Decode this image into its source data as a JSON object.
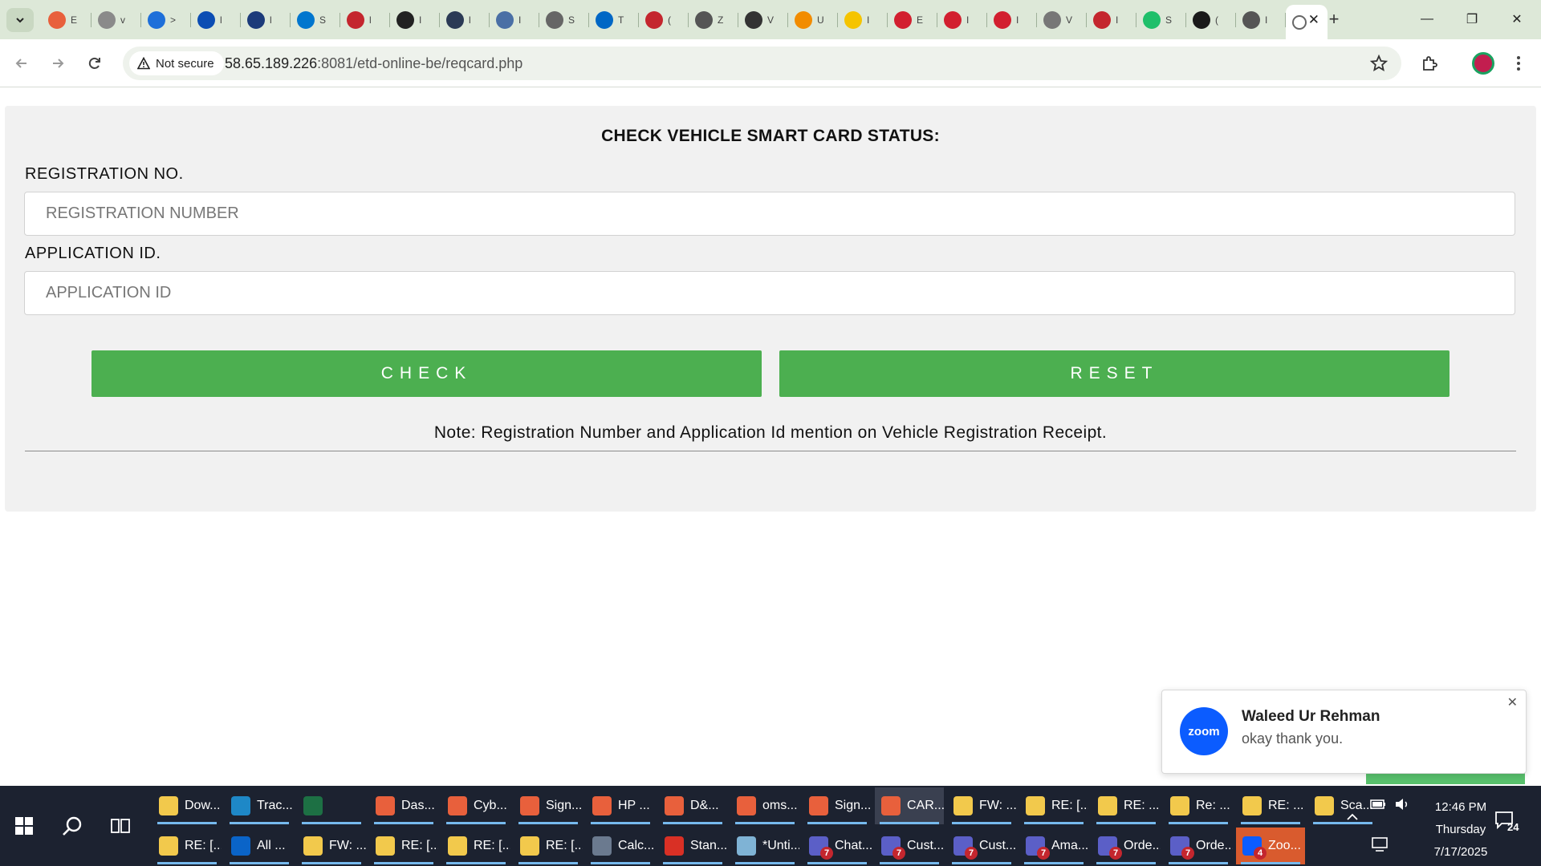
{
  "browser": {
    "tabs": [
      {
        "favicon": "chrome-icon",
        "color": "#e8603c",
        "title": "E"
      },
      {
        "favicon": "globe-icon",
        "color": "#8a8a8a",
        "title": "v"
      },
      {
        "favicon": "hand-icon",
        "color": "#1e6fd9",
        "title": ">"
      },
      {
        "favicon": "u-icon",
        "color": "#0b4db3",
        "title": "l"
      },
      {
        "favicon": "mail-icon",
        "color": "#1c3b7a",
        "title": "l"
      },
      {
        "favicon": "dell-icon",
        "color": "#0076ce",
        "title": "S"
      },
      {
        "favicon": "target-icon",
        "color": "#c4262e",
        "title": "l"
      },
      {
        "favicon": "m-icon",
        "color": "#222222",
        "title": "I"
      },
      {
        "favicon": "ring-icon",
        "color": "#2b3a55",
        "title": "l"
      },
      {
        "favicon": "compass-icon",
        "color": "#4a6fa5",
        "title": "I"
      },
      {
        "favicon": "globe-icon",
        "color": "#666666",
        "title": "S"
      },
      {
        "favicon": "etn-icon",
        "color": "#0067c5",
        "title": "T"
      },
      {
        "favicon": "plane-icon",
        "color": "#c4262e",
        "title": "("
      },
      {
        "favicon": "headset-icon",
        "color": "#555555",
        "title": "Z"
      },
      {
        "favicon": "horse-icon",
        "color": "#333333",
        "title": "V"
      },
      {
        "favicon": "u-orange-icon",
        "color": "#f28c00",
        "title": "U"
      },
      {
        "favicon": "fluke-icon",
        "color": "#f5c400",
        "title": "I"
      },
      {
        "favicon": "cube-icon",
        "color": "#d21f2f",
        "title": "E"
      },
      {
        "favicon": "shield-icon",
        "color": "#d21f2f",
        "title": "I"
      },
      {
        "favicon": "shield-icon",
        "color": "#d21f2f",
        "title": "I"
      },
      {
        "favicon": "linkedin-icon",
        "color": "#777777",
        "title": "V"
      },
      {
        "favicon": "target-icon",
        "color": "#c4262e",
        "title": "I"
      },
      {
        "favicon": "iq-icon",
        "color": "#1fbf6a",
        "title": "S"
      },
      {
        "favicon": "m-icon",
        "color": "#1a1a1a",
        "title": "("
      },
      {
        "favicon": "globe-icon",
        "color": "#555555",
        "title": "I"
      }
    ],
    "active_tab": {
      "title": "(",
      "close": "✕"
    },
    "new_tab": "+",
    "window": {
      "minimize": "—",
      "maximize": "❐",
      "close": "✕"
    },
    "address": {
      "security_label": "Not secure",
      "host": "58.65.189.226",
      "path": ":8081/etd-online-be/reqcard.php"
    }
  },
  "page": {
    "title": "CHECK VEHICLE SMART CARD STATUS:",
    "registration": {
      "label": "REGISTRATION NO.",
      "placeholder": "REGISTRATION NUMBER",
      "value": ""
    },
    "application": {
      "label": "APPLICATION ID.",
      "placeholder": "APPLICATION ID",
      "value": ""
    },
    "check_button": "CHECK",
    "reset_button": "RESET",
    "note": "Note: Registration Number and Application Id mention on Vehicle Registration Receipt.",
    "button_color": "#4caf50"
  },
  "zoom_toast": {
    "logo": "zoom",
    "sender": "Waleed Ur Rehman",
    "message": "okay thank you.",
    "close": "✕"
  },
  "taskbar": {
    "row1": [
      {
        "icon": "explorer-icon",
        "color": "#f2c94c",
        "label": "Dow..."
      },
      {
        "icon": "edge-icon",
        "color": "#1e88c7",
        "label": "Trac..."
      },
      {
        "icon": "excel-icon",
        "color": "#1d7044",
        "label": ""
      },
      {
        "icon": "chrome-icon",
        "color": "#e8603c",
        "label": "Das..."
      },
      {
        "icon": "chrome-icon",
        "color": "#e8603c",
        "label": "Cyb..."
      },
      {
        "icon": "chrome-icon",
        "color": "#e8603c",
        "label": "Sign..."
      },
      {
        "icon": "chrome-icon",
        "color": "#e8603c",
        "label": "HP ..."
      },
      {
        "icon": "chrome-icon",
        "color": "#e8603c",
        "label": "D&..."
      },
      {
        "icon": "chrome-icon",
        "color": "#e8603c",
        "label": "oms..."
      },
      {
        "icon": "chrome-icon",
        "color": "#e8603c",
        "label": "Sign..."
      },
      {
        "icon": "chrome-icon",
        "color": "#e8603c",
        "label": "CAR..."
      },
      {
        "icon": "mail-icon",
        "color": "#f2c94c",
        "label": "FW: ..."
      },
      {
        "icon": "mail-icon",
        "color": "#f2c94c",
        "label": "RE: [..."
      },
      {
        "icon": "mail-icon",
        "color": "#f2c94c",
        "label": "RE: ..."
      },
      {
        "icon": "mail-icon",
        "color": "#f2c94c",
        "label": "Re: ..."
      },
      {
        "icon": "mail-icon",
        "color": "#f2c94c",
        "label": "RE: ..."
      },
      {
        "icon": "mail-icon",
        "color": "#f2c94c",
        "label": "Sca..."
      }
    ],
    "row2": [
      {
        "icon": "mail-icon",
        "color": "#f2c94c",
        "label": "RE: [..."
      },
      {
        "icon": "outlook-icon",
        "color": "#0a64c8",
        "label": "All ..."
      },
      {
        "icon": "mail-icon",
        "color": "#f2c94c",
        "label": "FW: ..."
      },
      {
        "icon": "mail-icon",
        "color": "#f2c94c",
        "label": "RE: [..."
      },
      {
        "icon": "mail-icon",
        "color": "#f2c94c",
        "label": "RE: [..."
      },
      {
        "icon": "mail-icon",
        "color": "#f2c94c",
        "label": "RE: [..."
      },
      {
        "icon": "calculator-icon",
        "color": "#6b7a8f",
        "label": "Calc..."
      },
      {
        "icon": "pdf-icon",
        "color": "#d93025",
        "label": "Stan..."
      },
      {
        "icon": "notepad-icon",
        "color": "#7fb3d5",
        "label": "*Unti..."
      },
      {
        "icon": "teams-icon",
        "color": "#5b5fc7",
        "label": "Chat...",
        "badge": "7"
      },
      {
        "icon": "teams-icon",
        "color": "#5b5fc7",
        "label": "Cust...",
        "badge": "7"
      },
      {
        "icon": "teams-icon",
        "color": "#5b5fc7",
        "label": "Cust...",
        "badge": "7"
      },
      {
        "icon": "teams-icon",
        "color": "#5b5fc7",
        "label": "Ama...",
        "badge": "7"
      },
      {
        "icon": "teams-icon",
        "color": "#5b5fc7",
        "label": "Orde...",
        "badge": "7"
      },
      {
        "icon": "teams-icon",
        "color": "#5b5fc7",
        "label": "Orde...",
        "badge": "7"
      },
      {
        "icon": "zoom-icon",
        "color": "#0b5cff",
        "label": "Zoo...",
        "badge": "4"
      }
    ],
    "clock": {
      "time": "12:46 PM",
      "day": "Thursday",
      "date": "7/17/2025"
    },
    "notification_count": "24"
  }
}
